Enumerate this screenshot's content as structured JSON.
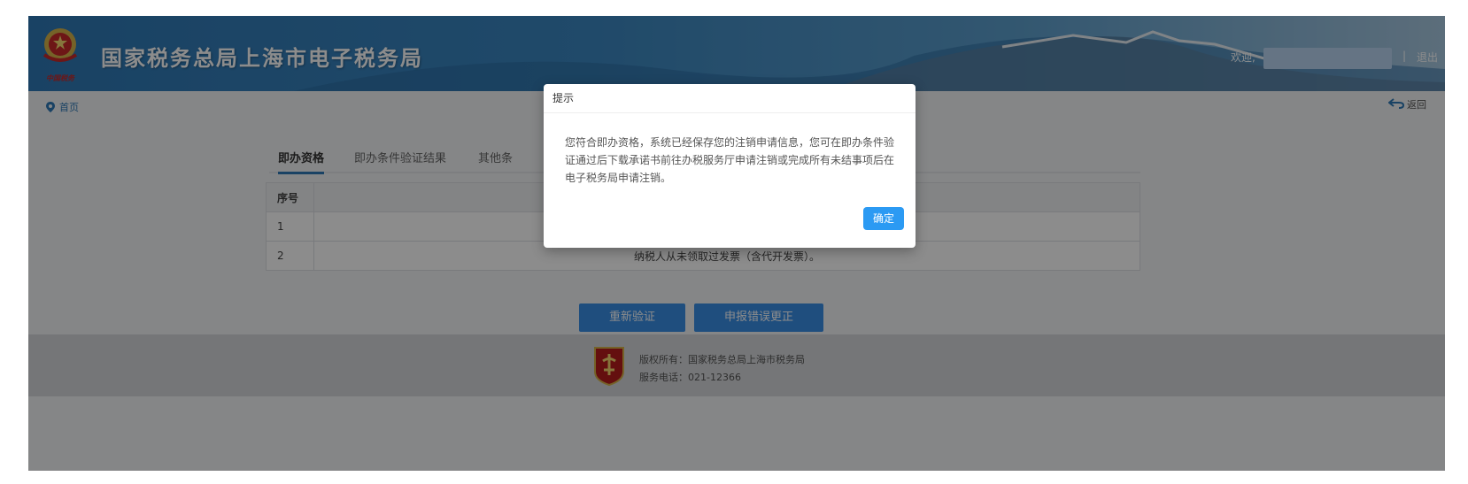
{
  "header": {
    "site_title": "国家税务总局上海市电子税务局",
    "emblem_caption": "中国税务",
    "welcome_label": "欢迎,",
    "separator": "|",
    "logout_label": "退出"
  },
  "breadcrumb": {
    "home_label": "首页"
  },
  "back_label": "返回",
  "tabs": [
    {
      "label": "即办资格",
      "active": true
    },
    {
      "label": "即办条件验证结果",
      "active": false
    },
    {
      "label": "其他条",
      "active": false
    }
  ],
  "table": {
    "headers": [
      "序号",
      ""
    ],
    "rows": [
      {
        "no": "1",
        "desc": ""
      },
      {
        "no": "2",
        "desc": "纳税人从未领取过发票（含代开发票）。"
      }
    ]
  },
  "buttons": {
    "reverify_label": "重新验证",
    "declare_label": "申报错误更正"
  },
  "footer": {
    "copyright": "版权所有：国家税务总局上海市税务局",
    "phone": "服务电话：021-12366"
  },
  "dialog": {
    "title": "提示",
    "message": "您符合即办资格，系统已经保存您的注销申请信息，您可在即办条件验证通过后下载承诺书前往办税服务厅申请注销或完成所有未结事项后在电子税务局申请注销。",
    "ok_label": "确定"
  },
  "colors": {
    "primary": "#2f79b6",
    "button": "#3a8ee6",
    "ok_button": "#2b9af3"
  }
}
